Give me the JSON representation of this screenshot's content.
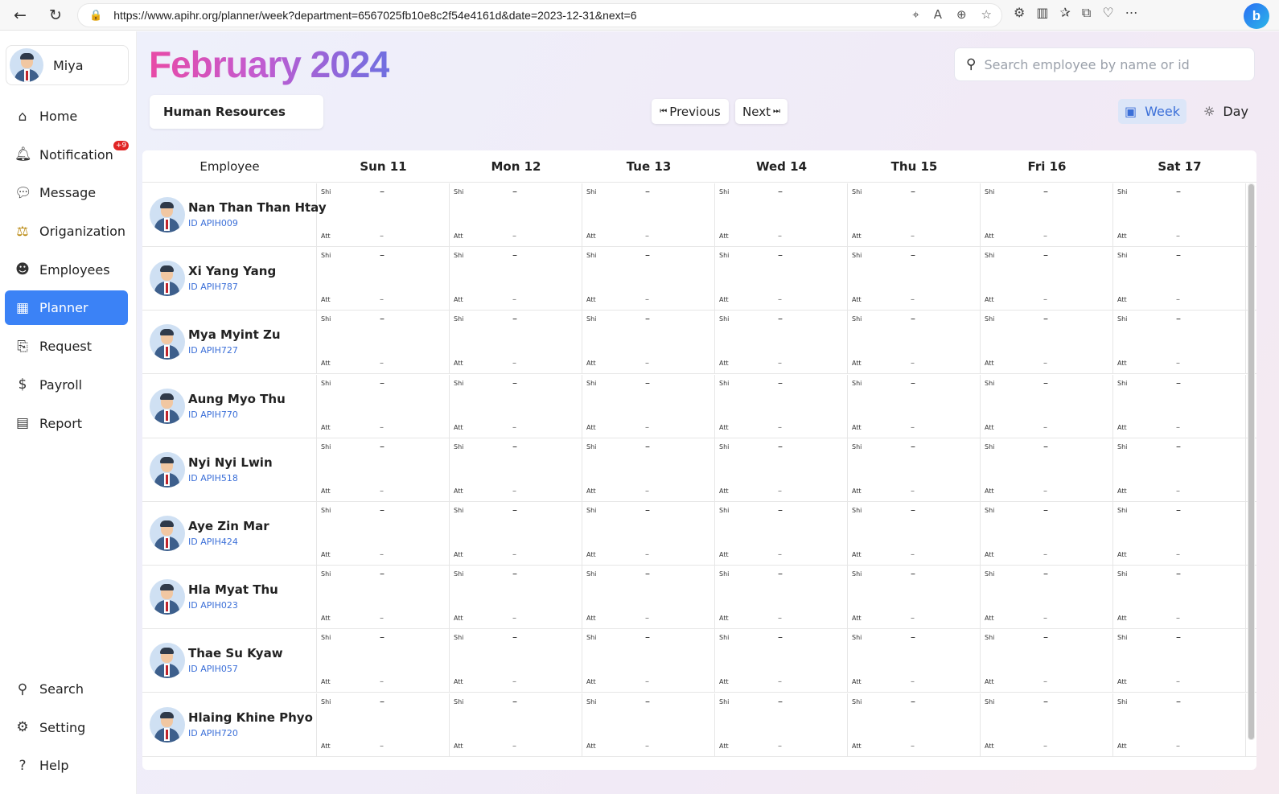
{
  "browser": {
    "url": "https://www.apihr.org/planner/week?department=6567025fb10e8c2f54e4161d&date=2023-12-31&next=6"
  },
  "sidebar": {
    "user_name": "Miya",
    "items": [
      {
        "label": "Home",
        "icon": "home-icon"
      },
      {
        "label": "Notification",
        "icon": "bell-icon",
        "badge": "+9"
      },
      {
        "label": "Message",
        "icon": "chat-icon"
      },
      {
        "label": "Origanization",
        "icon": "organization-icon"
      },
      {
        "label": "Employees",
        "icon": "users-icon"
      },
      {
        "label": "Planner",
        "icon": "calendar-icon",
        "active": true
      },
      {
        "label": "Request",
        "icon": "request-icon"
      },
      {
        "label": "Payroll",
        "icon": "dollar-icon"
      },
      {
        "label": "Report",
        "icon": "report-icon"
      }
    ],
    "bottom_items": [
      {
        "label": "Search",
        "icon": "search-icon"
      },
      {
        "label": "Setting",
        "icon": "gear-icon"
      },
      {
        "label": "Help",
        "icon": "help-icon"
      }
    ]
  },
  "header": {
    "month": "February 2024",
    "search_placeholder": "Search employee by name or id",
    "department": "Human Resources",
    "previous_label": "Previous",
    "next_label": "Next",
    "week_label": "Week",
    "day_label": "Day",
    "accent_color": "#3b82f6"
  },
  "table": {
    "employee_header": "Employee",
    "days": [
      "Sun 11",
      "Mon 12",
      "Tue 13",
      "Wed 14",
      "Thu 15",
      "Fri 16",
      "Sat 17"
    ],
    "shift_label": "Shi",
    "att_label": "Att",
    "shift_value": "–",
    "att_value": "–",
    "employees": [
      {
        "name": "Nan Than Than Htay",
        "id": "ID APIH009"
      },
      {
        "name": "Xi Yang Yang",
        "id": "ID APIH787"
      },
      {
        "name": "Mya Myint Zu",
        "id": "ID APIH727"
      },
      {
        "name": "Aung Myo Thu",
        "id": "ID APIH770"
      },
      {
        "name": "Nyi Nyi Lwin",
        "id": "ID APIH518"
      },
      {
        "name": "Aye Zin Mar",
        "id": "ID APIH424"
      },
      {
        "name": "Hla Myat Thu",
        "id": "ID APIH023"
      },
      {
        "name": "Thae Su Kyaw",
        "id": "ID APIH057"
      },
      {
        "name": "Hlaing Khine Phyo",
        "id": "ID APIH720"
      }
    ]
  }
}
